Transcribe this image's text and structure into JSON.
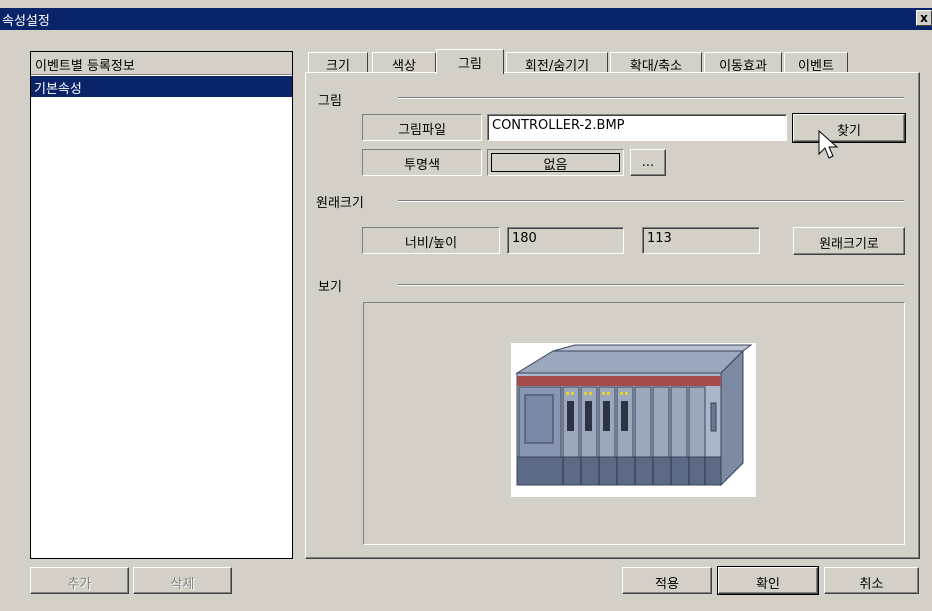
{
  "window": {
    "title": "속성설정",
    "close_label": "x"
  },
  "left_panel": {
    "header": "이벤트별 등록정보",
    "items": [
      "기본속성"
    ],
    "add_label": "추가",
    "delete_label": "삭제"
  },
  "tabs": [
    {
      "label": "크기"
    },
    {
      "label": "색상"
    },
    {
      "label": "그림",
      "active": true
    },
    {
      "label": "회전/숨기기"
    },
    {
      "label": "확대/축소"
    },
    {
      "label": "이동효과"
    },
    {
      "label": "이벤트"
    }
  ],
  "picture_group": {
    "title": "그림",
    "file_label": "그림파일",
    "file_value": "CONTROLLER-2.BMP",
    "browse_label": "찾기",
    "transparent_label": "투명색",
    "transparent_value": "없음",
    "ellipsis_label": "..."
  },
  "size_group": {
    "title": "원래크기",
    "wh_label": "너비/높이",
    "width": "180",
    "height": "113",
    "reset_label": "원래크기로"
  },
  "preview_group": {
    "title": "보기",
    "image_icon": "plc-controller-image"
  },
  "footer": {
    "apply_label": "적용",
    "ok_label": "확인",
    "cancel_label": "취소"
  },
  "colors": {
    "titlebar": "#0a246a",
    "face": "#d4d0c8",
    "selection": "#0a246a"
  }
}
